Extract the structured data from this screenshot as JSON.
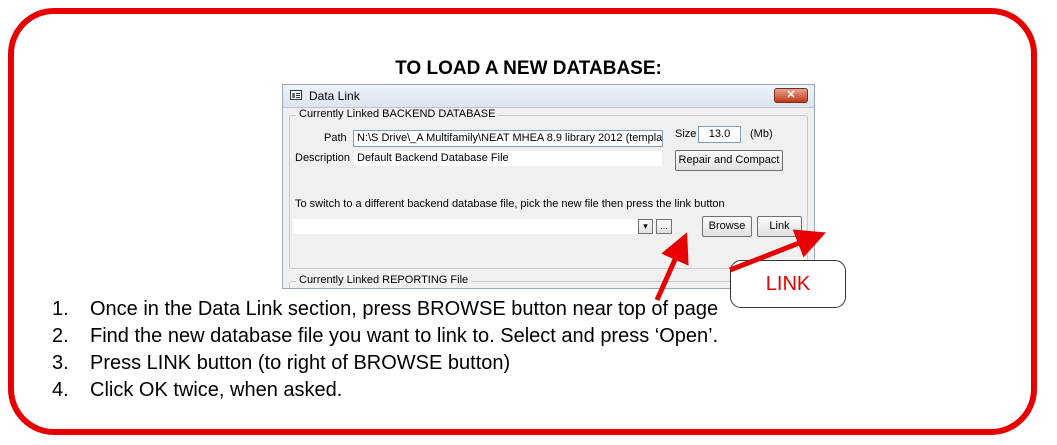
{
  "heading": "TO LOAD A NEW DATABASE:",
  "dialog": {
    "title": "Data Link",
    "close_glyph": "✕",
    "backend_group": {
      "legend": "Currently Linked BACKEND DATABASE",
      "path_label": "Path",
      "path_value": "N:\\S Drive\\_A Multifamily\\NEAT MHEA 8.9 library 2012 (templat",
      "size_label": "Size",
      "size_value": "13.0",
      "size_unit": "(Mb)",
      "description_label": "Description",
      "description_value": "Default Backend Database File",
      "repair_button": "Repair and Compact",
      "switch_instruction": "To switch to a different backend database file, pick the new file then press the link button",
      "dropdown_glyph": "▾",
      "ellipsis_label": "...",
      "browse_button": "Browse",
      "link_button": "Link"
    },
    "reporting_group": {
      "legend": "Currently Linked REPORTING File"
    }
  },
  "callout_label": "LINK",
  "steps": [
    {
      "num": "1.",
      "text": "Once in the Data Link section, press BROWSE button near top of page"
    },
    {
      "num": "2.",
      "text": "Find the new database file you want to link to.  Select and press ‘Open’."
    },
    {
      "num": "3.",
      "text": "Press LINK button (to right of BROWSE button)"
    },
    {
      "num": "4.",
      "text": "Click OK twice, when asked."
    }
  ],
  "colors": {
    "frame_red": "#e60000",
    "window_bg": "#f0f0f0"
  },
  "icons": [
    "data-link-app-icon",
    "close-icon",
    "dropdown-arrow-icon"
  ]
}
